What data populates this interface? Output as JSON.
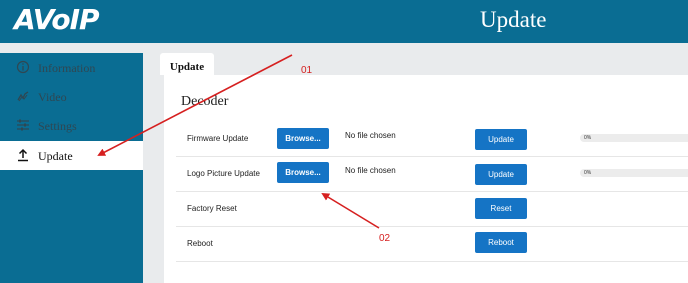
{
  "header": {
    "logo": "AVoIP",
    "title": "Update",
    "color": "#0a6d93"
  },
  "sidebar": {
    "items": [
      {
        "label": "Information",
        "icon": "info-icon"
      },
      {
        "label": "Video",
        "icon": "video-icon"
      },
      {
        "label": "Settings",
        "icon": "settings-icon"
      },
      {
        "label": "Update",
        "icon": "upload-icon",
        "active": true
      }
    ]
  },
  "main": {
    "tab": "Update",
    "section_title": "Decoder",
    "rows": [
      {
        "label": "Firmware Update",
        "browse": "Browse...",
        "file": "No file chosen",
        "action": "Update",
        "progress": "0%"
      },
      {
        "label": "Logo Picture Update",
        "browse": "Browse...",
        "file": "No file chosen",
        "action": "Update",
        "progress": "0%"
      },
      {
        "label": "Factory Reset",
        "action": "Reset"
      },
      {
        "label": "Reboot",
        "action": "Reboot"
      }
    ]
  },
  "annotations": {
    "a1": "01",
    "a2": "02",
    "color": "#d62020"
  }
}
